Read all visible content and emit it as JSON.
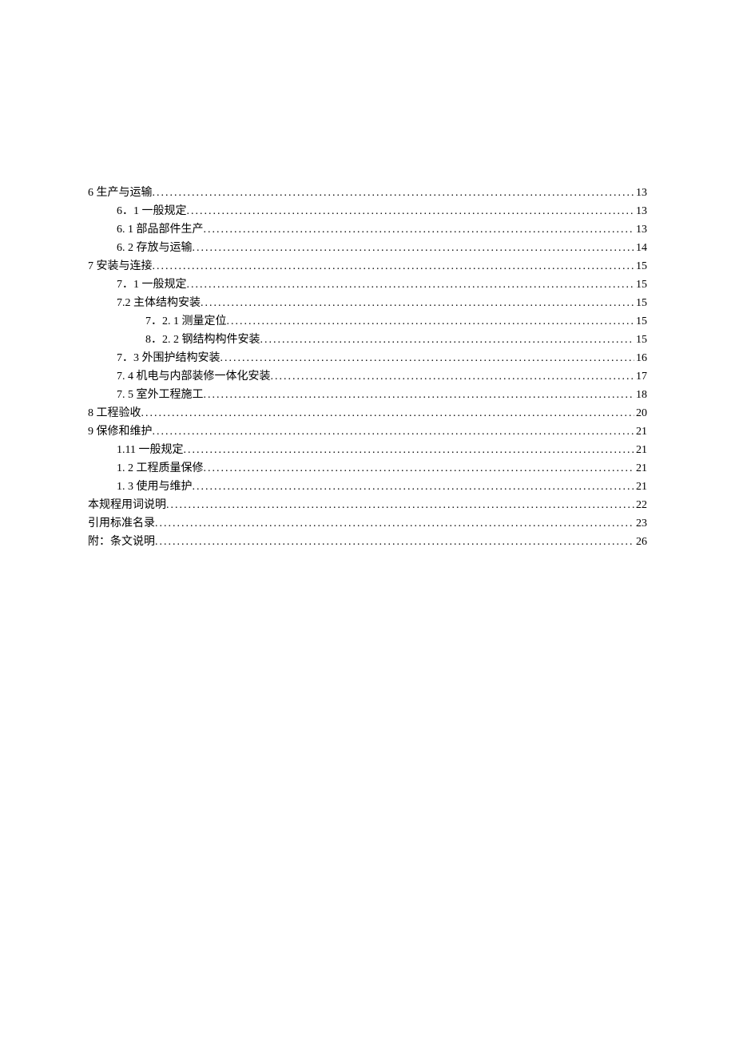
{
  "toc": [
    {
      "indent": 0,
      "label": "6 生产与运输 ",
      "page": "13"
    },
    {
      "indent": 1,
      "label": "6．1 一般规定",
      "page": "13"
    },
    {
      "indent": 1,
      "label": "6. 1  部品部件生产",
      "page": "13"
    },
    {
      "indent": 1,
      "label": "6. 2  存放与运输",
      "page": "14"
    },
    {
      "indent": 0,
      "label": "7 安装与连接 ",
      "page": "15"
    },
    {
      "indent": 1,
      "label": "7．1 一般规定",
      "page": "15"
    },
    {
      "indent": 1,
      "label": "7.2 主体结构安装 ",
      "page": "15"
    },
    {
      "indent": 2,
      "label": "7．2. 1 测量定位",
      "page": "15"
    },
    {
      "indent": 2,
      "label": "8．2. 2 钢结构构件安装",
      "page": "15"
    },
    {
      "indent": 1,
      "label": "7．3 外围护结构安装",
      "page": "16"
    },
    {
      "indent": 1,
      "label": "7. 4  机电与内部装修一体化安装",
      "page": "17"
    },
    {
      "indent": 1,
      "label": "7. 5  室外工程施工",
      "page": "18"
    },
    {
      "indent": 0,
      "label": "8 工程验收 ",
      "page": "20"
    },
    {
      "indent": 0,
      "label": "9 保修和维护 ",
      "page": "21"
    },
    {
      "indent": 1,
      "label": "1.11 一般规定",
      "page": "21"
    },
    {
      "indent": 1,
      "label": "1. 2  工程质量保修",
      "page": "21"
    },
    {
      "indent": 1,
      "label": "1. 3  使用与维护",
      "page": "21"
    },
    {
      "indent": 0,
      "label": "本规程用词说明",
      "page": "22"
    },
    {
      "indent": 0,
      "label": "引用标准名录",
      "page": "23"
    },
    {
      "indent": 0,
      "label": "附：条文说明",
      "page": "26"
    }
  ]
}
